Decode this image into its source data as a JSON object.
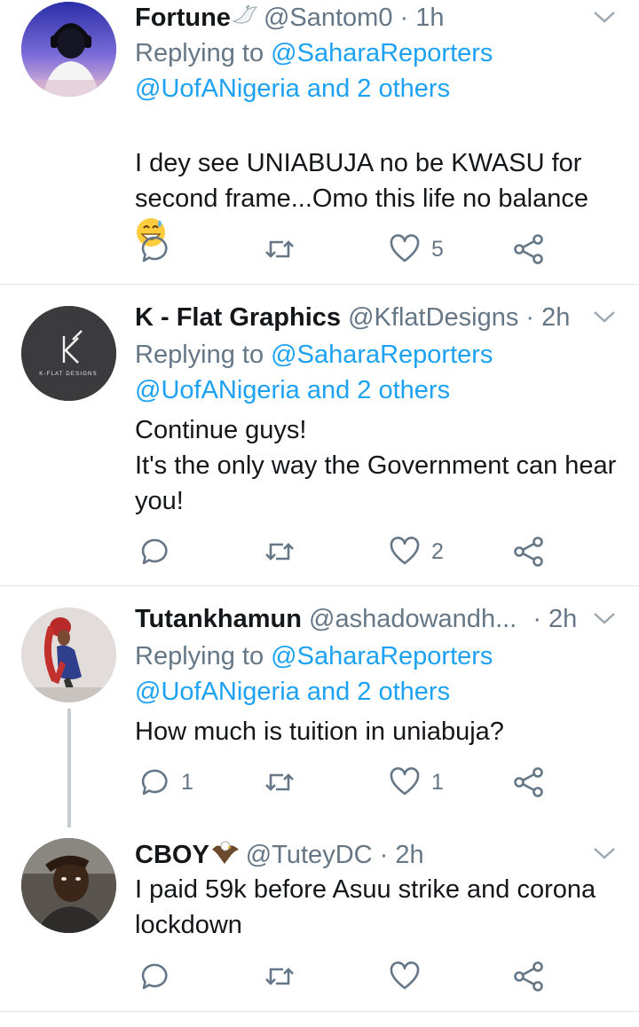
{
  "tweets": [
    {
      "name": "Fortune",
      "handle": "@Santom0",
      "dot": "·",
      "time": "1h",
      "badge_icon": "dove-emoji",
      "replying_label": "Replying to",
      "replying_users": "@SaharaReporters",
      "replying_others": "@UofANigeria and 2 others",
      "text": "I dey see UNIABUJA no be KWASU  for second frame...Omo this life no balance",
      "trailing_emoji": "grinning-sweat-emoji",
      "actions": {
        "replies": "",
        "retweets": "",
        "likes": "5"
      }
    },
    {
      "name": "K - Flat Graphics",
      "handle": "@KflatDesigns",
      "dot": "·",
      "time": "2h",
      "replying_label": "Replying to",
      "replying_users": "@SaharaReporters",
      "replying_others": "@UofANigeria and 2 others",
      "text": "Continue guys!\nIt's the only way the Government can hear you!",
      "avatar_logo_text": "K-FLAT DESIGNS",
      "actions": {
        "replies": "",
        "retweets": "",
        "likes": "2"
      }
    },
    {
      "name": "Tutankhamun",
      "handle": "@ashadowandh...",
      "dot": "·",
      "time": "2h",
      "replying_label": "Replying to",
      "replying_users": "@SaharaReporters",
      "replying_others": "@UofANigeria and 2 others",
      "text": "How much is tuition in uniabuja?",
      "actions": {
        "replies": "1",
        "retweets": "",
        "likes": "1"
      }
    },
    {
      "name": "CBOY",
      "handle": "@TuteyDC",
      "dot": "·",
      "time": "2h",
      "badge_icon": "eagle-emoji",
      "text": "I paid 59k before Asuu strike and corona lockdown",
      "actions": {
        "replies": "",
        "retweets": "",
        "likes": ""
      }
    }
  ],
  "colors": {
    "link": "#1da1f2",
    "secondary_text": "#657786",
    "separator": "#dfe3e6",
    "thread_line": "#c4cdd4"
  }
}
